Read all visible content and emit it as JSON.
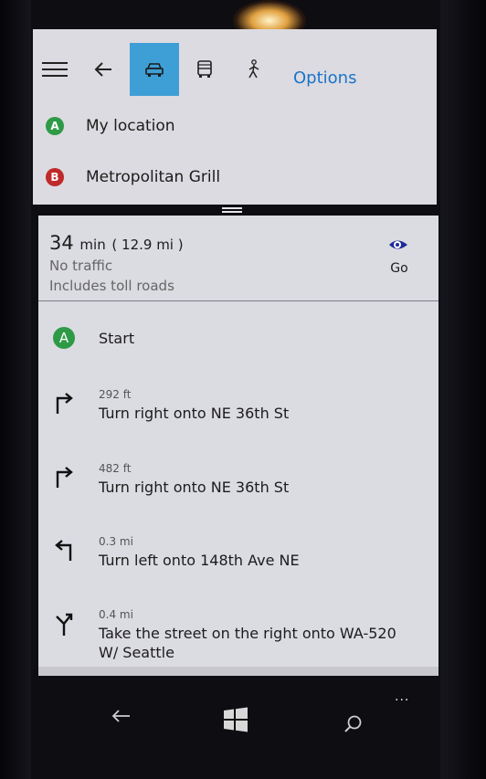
{
  "toolbar": {
    "options_label": "Options",
    "icons": [
      "hamburger-menu-icon",
      "back-arrow-icon",
      "car-icon",
      "bus-icon",
      "walk-icon"
    ],
    "active_mode": "car",
    "accent_color": "#3e9fd6",
    "link_color": "#1a74c8"
  },
  "route": {
    "start": {
      "badge": "A",
      "label": "My location",
      "color": "#2e9a46"
    },
    "end": {
      "badge": "B",
      "label": "Metropolitan Grill",
      "color": "#c02a2a"
    }
  },
  "summary": {
    "duration_value": "34",
    "duration_unit": "min",
    "distance": "( 12.9 mi )",
    "traffic": "No traffic",
    "note": "Includes toll roads",
    "go_label": "Go"
  },
  "steps": [
    {
      "icon": "start-badge",
      "badge": "A",
      "distance": "",
      "text": "Start"
    },
    {
      "icon": "turn-right-icon",
      "distance": "292 ft",
      "text": "Turn right onto NE 36th St"
    },
    {
      "icon": "turn-right-icon",
      "distance": "482 ft",
      "text": "Turn right onto NE 36th St"
    },
    {
      "icon": "turn-left-icon",
      "distance": "0.3 mi",
      "text": "Turn left onto 148th Ave NE"
    },
    {
      "icon": "keep-right-fork-icon",
      "distance": "0.4 mi",
      "text": "Take the street on the right onto WA-520 W/ Seattle"
    }
  ],
  "appbar": {
    "more": "..."
  },
  "system_nav": [
    "back-icon",
    "windows-start-icon",
    "search-icon"
  ]
}
